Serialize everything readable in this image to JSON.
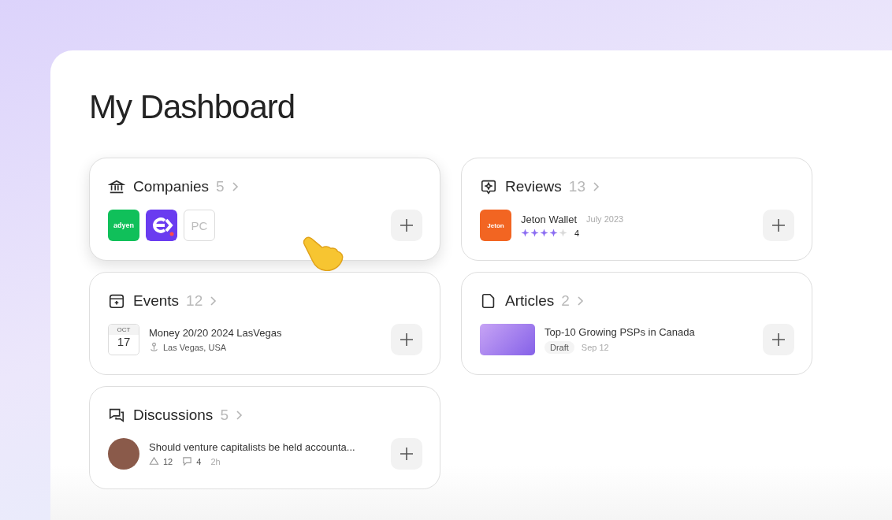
{
  "page_title": "My Dashboard",
  "sections": [
    {
      "kind": "companies",
      "title": "Companies",
      "count": "5",
      "highlighted": true,
      "logos": [
        {
          "kind": "wordmark",
          "text": "adyen",
          "color": "#10c05a"
        },
        {
          "kind": "mark",
          "color": "#6a3cf0"
        },
        {
          "kind": "initials",
          "text": "PC"
        }
      ]
    },
    {
      "kind": "review",
      "title": "Reviews",
      "count": "13",
      "highlighted": false,
      "item": {
        "logo_text": "Jeton",
        "name": "Jeton Wallet",
        "date": "July 2023",
        "stars": 4,
        "rating": "4"
      }
    },
    {
      "kind": "event",
      "title": "Events",
      "count": "12",
      "highlighted": false,
      "item": {
        "month": "OCT",
        "day": "17",
        "name": "Money 20/20 2024 LasVegas",
        "location": "Las Vegas, USA"
      }
    },
    {
      "kind": "article",
      "title": "Articles",
      "count": "2",
      "highlighted": false,
      "item": {
        "name": "Top-10 Growing PSPs in Canada",
        "status": "Draft",
        "date": "Sep 12"
      }
    },
    {
      "kind": "discussion",
      "title": "Discussions",
      "count": "5",
      "highlighted": false,
      "item": {
        "name": "Should venture capitalists be held accounta...",
        "votes": "12",
        "comments": "4",
        "age": "2h"
      }
    }
  ]
}
